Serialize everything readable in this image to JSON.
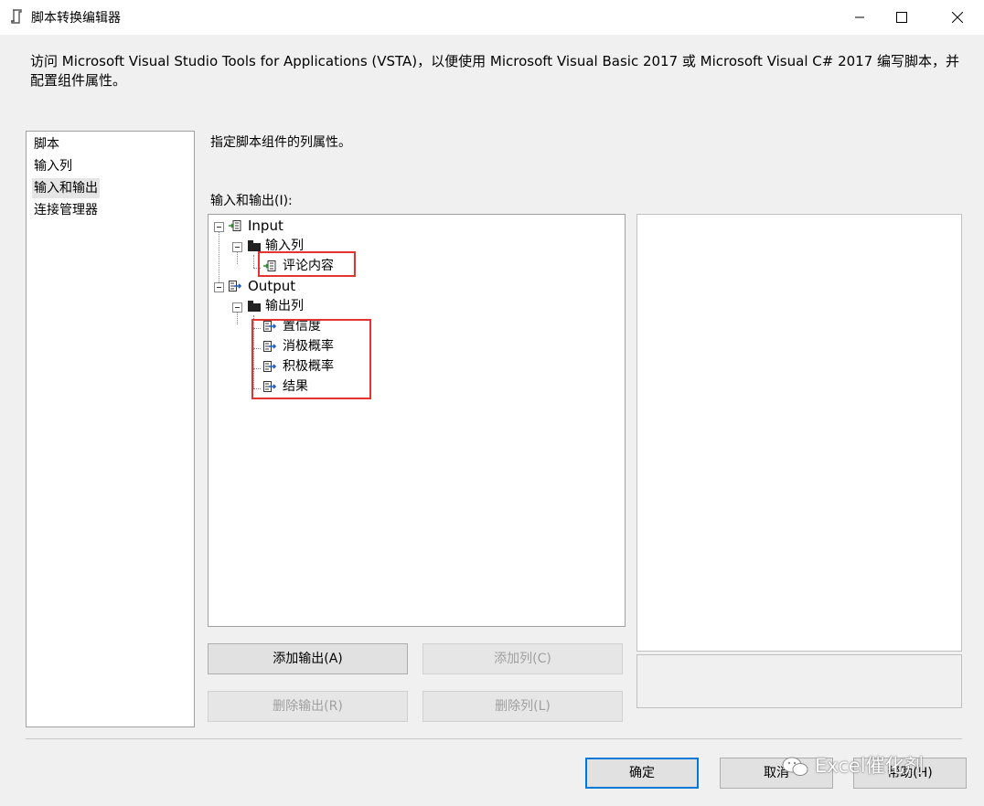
{
  "window": {
    "title": "脚本转换编辑器",
    "controls": {
      "minimize": "minimize",
      "maximize": "maximize",
      "close": "close"
    }
  },
  "description": "访问 Microsoft Visual Studio Tools for Applications (VSTA)，以便使用 Microsoft Visual Basic 2017 或 Microsoft Visual C# 2017 编写脚本，并配置组件属性。",
  "sidebar": {
    "items": [
      {
        "label": "脚本"
      },
      {
        "label": "输入列"
      },
      {
        "label": "输入和输出",
        "selected": true
      },
      {
        "label": "连接管理器"
      }
    ]
  },
  "main": {
    "hint": "指定脚本组件的列属性。",
    "tree_label": "输入和输出(I):",
    "tree": {
      "input": {
        "label": "Input",
        "columns_label": "输入列",
        "columns": [
          "评论内容"
        ]
      },
      "output": {
        "label": "Output",
        "columns_label": "输出列",
        "columns": [
          "置信度",
          "消极概率",
          "积极概率",
          "结果"
        ]
      }
    },
    "buttons": {
      "add_output": "添加输出(A)",
      "add_column": "添加列(C)",
      "remove_output": "删除输出(R)",
      "remove_column": "删除列(L)"
    }
  },
  "footer": {
    "ok": "确定",
    "cancel": "取消",
    "help": "帮助(H)"
  },
  "watermark": "Excel催化剂",
  "colors": {
    "highlight_box": "#e53333",
    "default_button_border": "#0078d7"
  }
}
